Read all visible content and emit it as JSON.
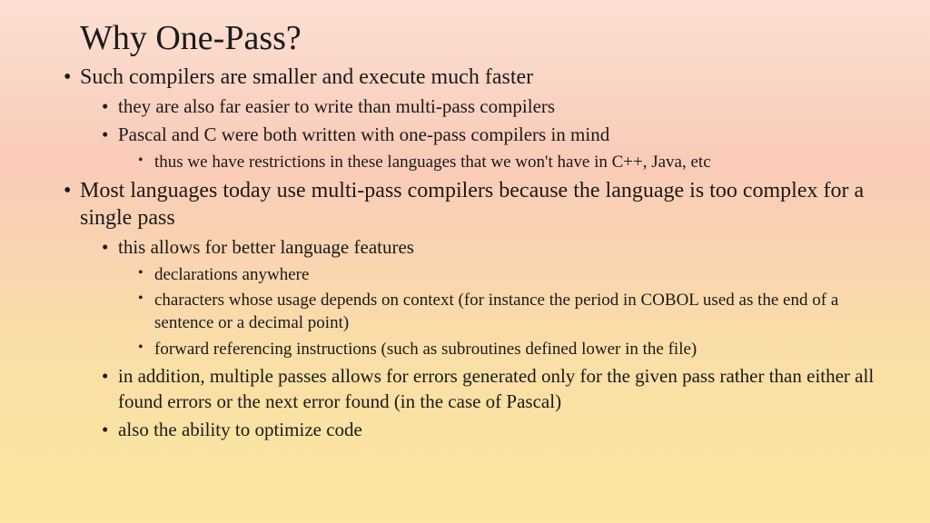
{
  "title": "Why One-Pass?",
  "b1": "Such compilers are smaller and execute much faster",
  "b1_1": "they are also far easier to write than multi-pass compilers",
  "b1_2": "Pascal and C were both written with one-pass compilers in mind",
  "b1_2_1": "thus we have restrictions in these languages that we won't have in C++, Java, etc",
  "b2": "Most languages today use multi-pass compilers because the language is too complex for a single pass",
  "b2_1": "this allows for better language features",
  "b2_1_1": "declarations anywhere",
  "b2_1_2": "characters whose usage depends on context (for instance the period in COBOL used as the end of a sentence or a decimal point)",
  "b2_1_3": "forward referencing instructions (such as subroutines defined lower in the file)",
  "b2_2": "in addition, multiple passes allows for errors generated only for the given pass rather than either all found errors or the next error found (in the case of Pascal)",
  "b2_3": "also the ability to optimize code"
}
